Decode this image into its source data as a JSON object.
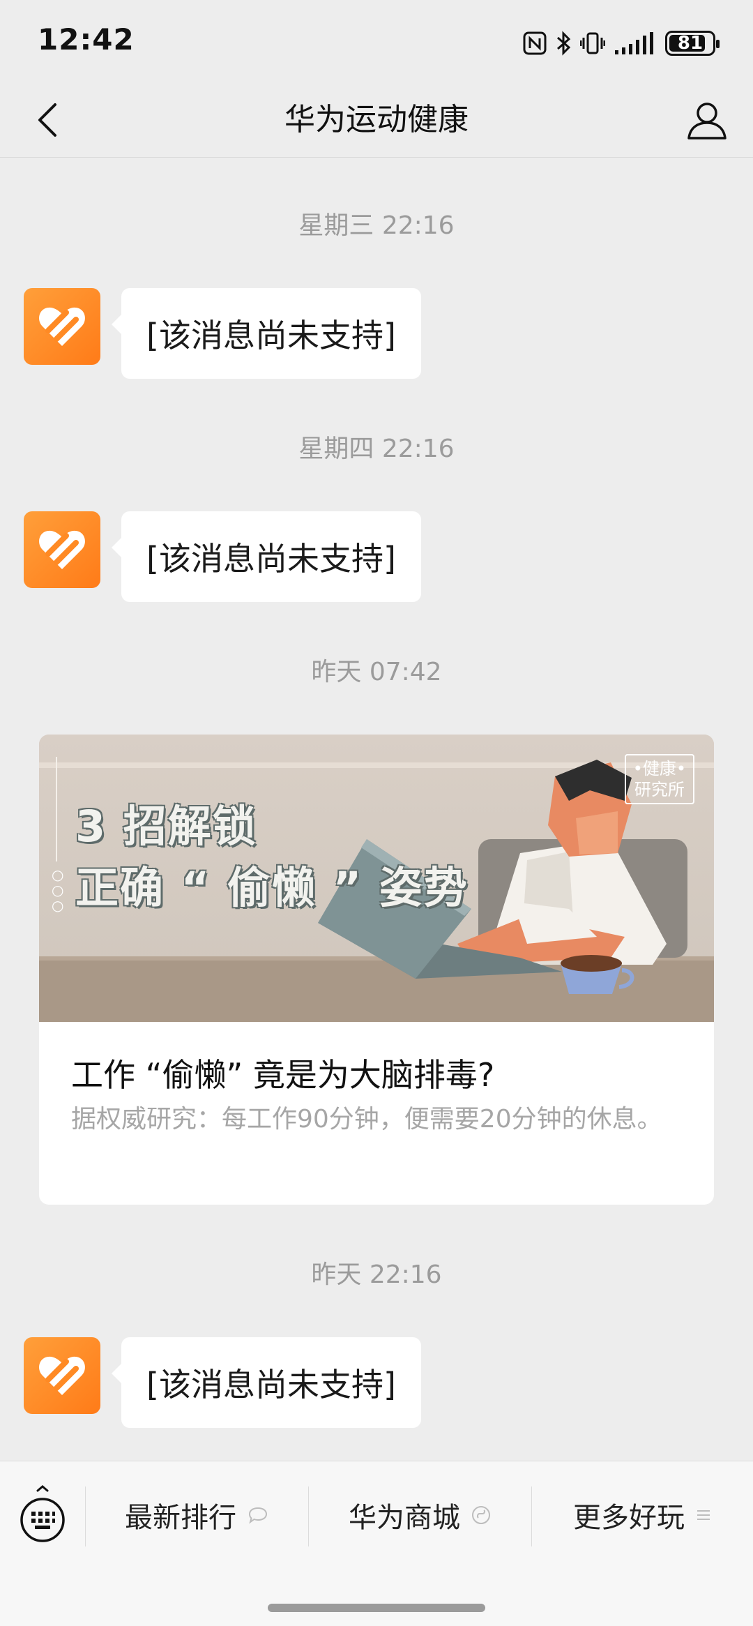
{
  "status_bar": {
    "time": "12:42",
    "battery": "81",
    "icons": [
      "nfc-icon",
      "bluetooth-icon",
      "vibrate-icon",
      "signal-icon",
      "battery-icon"
    ]
  },
  "header": {
    "title": "华为运动健康",
    "back_icon": "chevron-left-icon",
    "profile_icon": "person-icon"
  },
  "messages": [
    {
      "time": "星期三 22:16",
      "text": "[该消息尚未支持]"
    },
    {
      "time": "星期四 22:16",
      "text": "[该消息尚未支持]"
    },
    {
      "time": "昨天 07:42",
      "article": {
        "cover_line1": "3 招解锁",
        "cover_line2": "正确 “ 偷懒 ” 姿势",
        "badge_line1": "•健康•",
        "badge_line2": "研究所",
        "title": "工作 “偷懒” 竟是为大脑排毒?",
        "desc": "据权威研究：每工作90分钟，便需要20分钟的休息。"
      }
    },
    {
      "time": "昨天 22:16",
      "text": "[该消息尚未支持]"
    }
  ],
  "menu": {
    "keyboard_icon": "keyboard-icon",
    "items": [
      {
        "label": "最新排行",
        "icon": "chat-bubble-icon"
      },
      {
        "label": "华为商城",
        "icon": "mini-program-icon"
      },
      {
        "label": "更多好玩",
        "icon": "menu-lines-icon"
      }
    ]
  },
  "colors": {
    "background": "#ededed",
    "avatar": "#ff8a24",
    "bubble": "#ffffff"
  }
}
